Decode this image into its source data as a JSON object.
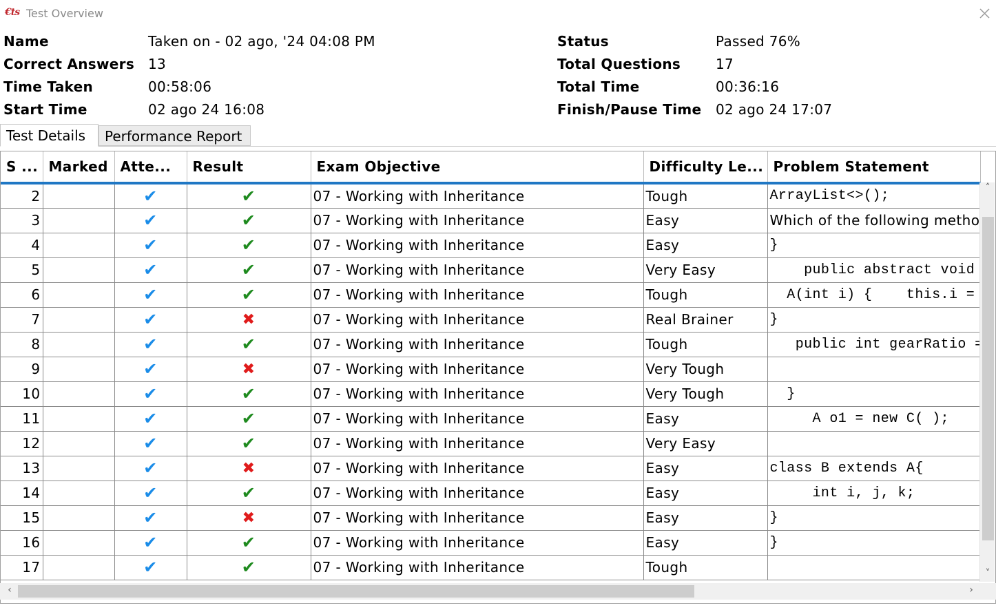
{
  "window": {
    "logo": "€ts",
    "title": "Test Overview",
    "close_icon": "close-icon"
  },
  "summary": {
    "name_label": "Name",
    "name_value": "Taken on - 02 ago, '24 04:08 PM",
    "correct_label": "Correct Answers",
    "correct_value": "13",
    "time_taken_label": "Time Taken",
    "time_taken_value": "00:58:06",
    "start_label": "Start Time",
    "start_value": "02 ago 24 16:08",
    "status_label": "Status",
    "status_value": "Passed 76%",
    "total_q_label": "Total Questions",
    "total_q_value": "17",
    "total_time_label": "Total Time",
    "total_time_value": "00:36:16",
    "finish_label": "Finish/Pause Time",
    "finish_value": "02 ago 24 17:07"
  },
  "tabs": [
    {
      "label": "Test Details",
      "active": true
    },
    {
      "label": "Performance Report",
      "active": false
    }
  ],
  "table": {
    "columns": [
      "S ...",
      "Marked",
      "Atte...",
      "Result",
      "Exam Objective",
      "Difficulty Le...",
      "Problem Statement"
    ],
    "rows": [
      {
        "sn": "2",
        "marked": "",
        "attempted": true,
        "result": "pass",
        "objective": "07 - Working with Inheritance",
        "difficulty": "Tough",
        "problem": "ArrayList<>();",
        "problem_plain": false
      },
      {
        "sn": "3",
        "marked": "",
        "attempted": true,
        "result": "pass",
        "objective": "07 - Working with Inheritance",
        "difficulty": "Easy",
        "problem": "Which of the following metho",
        "problem_plain": true
      },
      {
        "sn": "4",
        "marked": "",
        "attempted": true,
        "result": "pass",
        "objective": "07 - Working with Inheritance",
        "difficulty": "Easy",
        "problem": "}",
        "problem_plain": false
      },
      {
        "sn": "5",
        "marked": "",
        "attempted": true,
        "result": "pass",
        "objective": "07 - Working with Inheritance",
        "difficulty": "Very Easy",
        "problem": "    public abstract void r",
        "problem_plain": false
      },
      {
        "sn": "6",
        "marked": "",
        "attempted": true,
        "result": "pass",
        "objective": "07 - Working with Inheritance",
        "difficulty": "Tough",
        "problem": "  A(int i) {    this.i = i",
        "problem_plain": false
      },
      {
        "sn": "7",
        "marked": "",
        "attempted": true,
        "result": "fail",
        "objective": "07 - Working with Inheritance",
        "difficulty": "Real Brainer",
        "problem": "}",
        "problem_plain": false
      },
      {
        "sn": "8",
        "marked": "",
        "attempted": true,
        "result": "pass",
        "objective": "07 - Working with Inheritance",
        "difficulty": "Tough",
        "problem": "   public int gearRatio =",
        "problem_plain": false
      },
      {
        "sn": "9",
        "marked": "",
        "attempted": true,
        "result": "fail",
        "objective": "07 - Working with Inheritance",
        "difficulty": "Very Tough",
        "problem": "",
        "problem_plain": false
      },
      {
        "sn": "10",
        "marked": "",
        "attempted": true,
        "result": "pass",
        "objective": "07 - Working with Inheritance",
        "difficulty": "Very Tough",
        "problem": "  }",
        "problem_plain": false
      },
      {
        "sn": "11",
        "marked": "",
        "attempted": true,
        "result": "pass",
        "objective": "07 - Working with Inheritance",
        "difficulty": "Easy",
        "problem": "     A o1 = new C( );",
        "problem_plain": false
      },
      {
        "sn": "12",
        "marked": "",
        "attempted": true,
        "result": "pass",
        "objective": "07 - Working with Inheritance",
        "difficulty": "Very Easy",
        "problem": "",
        "problem_plain": false
      },
      {
        "sn": "13",
        "marked": "",
        "attempted": true,
        "result": "fail",
        "objective": "07 - Working with Inheritance",
        "difficulty": "Easy",
        "problem": "class B extends A{",
        "problem_plain": false
      },
      {
        "sn": "14",
        "marked": "",
        "attempted": true,
        "result": "pass",
        "objective": "07 - Working with Inheritance",
        "difficulty": "Easy",
        "problem": "     int i, j, k;",
        "problem_plain": false
      },
      {
        "sn": "15",
        "marked": "",
        "attempted": true,
        "result": "fail",
        "objective": "07 - Working with Inheritance",
        "difficulty": "Easy",
        "problem": "}",
        "problem_plain": false
      },
      {
        "sn": "16",
        "marked": "",
        "attempted": true,
        "result": "pass",
        "objective": "07 - Working with Inheritance",
        "difficulty": "Easy",
        "problem": "}",
        "problem_plain": false
      },
      {
        "sn": "17",
        "marked": "",
        "attempted": true,
        "result": "pass",
        "objective": "07 - Working with Inheritance",
        "difficulty": "Tough",
        "problem": "",
        "problem_plain": false
      }
    ]
  },
  "colors": {
    "header_underline": "#1f77c4",
    "check_attempted": "#1a8ce8",
    "check_pass": "#1e8a1e",
    "cross_fail": "#e01b1b",
    "logo": "#c0272d"
  }
}
